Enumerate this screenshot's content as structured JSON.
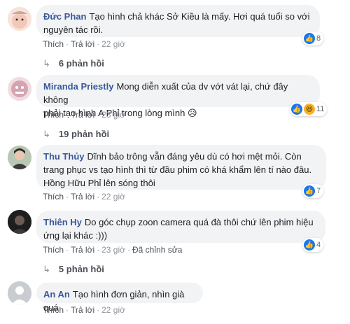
{
  "comments": [
    {
      "author": "Đức Phan",
      "text_line1": "Tạo hình chả khác Sở Kiều là mấy. Hơi quá tuổi so với",
      "text_line2": "nguyên tác rồi.",
      "reaction_count": "8",
      "like_label": "Thích",
      "reply_label": "Trả lời",
      "time": "22 giờ",
      "replies_label": "6 phản hồi"
    },
    {
      "author": "Miranda Priestly",
      "text_line1": "Mong diễn xuất của dv vớt vát lại, chứ đây không",
      "text_line2": "phải tạo hình A Phỉ trong lòng mình 😥",
      "reaction_count": "11",
      "like_label": "Thích",
      "reply_label": "Trả lời",
      "time": "23 giờ",
      "replies_label": "19 phản hồi"
    },
    {
      "author": "Thu Thủy",
      "text_line1": "Dĩnh bảo trông vẫn đáng yêu dù có hơi mệt mỏi. Còn",
      "text_line2": "trang phục vs tạo hình thì từ đầu phim có khá khẩm lên tí nào đâu.",
      "text_line3": "Hồng Hữu Phỉ lên sóng thôi",
      "reaction_count": "7",
      "like_label": "Thích",
      "reply_label": "Trả lời",
      "time": "22 giờ"
    },
    {
      "author": "Thiên Hy",
      "text_line1": "Do góc chụp zoon camera quá đà thôi chứ lên phim hiệu",
      "text_line2": "ứng lại khác :)))",
      "reaction_count": "4",
      "like_label": "Thích",
      "reply_label": "Trả lời",
      "time": "23 giờ",
      "edited_label": "Đã chỉnh sửa",
      "replies_label": "5 phản hồi"
    },
    {
      "author": "An An",
      "text_line1": "Tạo hình đơn giản, nhìn già quá",
      "like_label": "Thích",
      "reply_label": "Trả lời",
      "time": "22 giờ"
    }
  ],
  "colors": {
    "author": "#385898",
    "bubble": "#f2f3f5",
    "like": "#1877f2"
  },
  "icons": {
    "like": "thumbs-up-icon",
    "haha": "haha-icon",
    "reply_arrow": "reply-arrow-icon"
  }
}
